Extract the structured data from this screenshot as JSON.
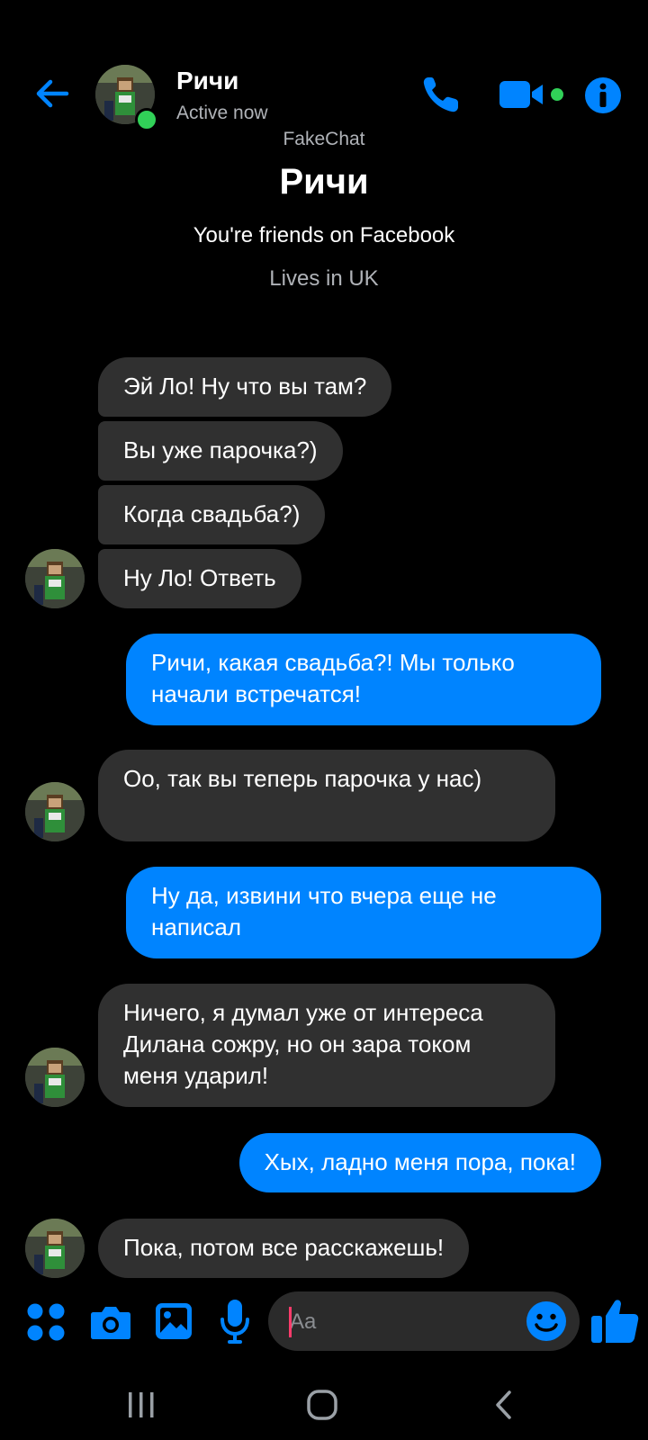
{
  "header": {
    "contact_name": "Ричи",
    "status": "Active now",
    "watermark": "FakeChat",
    "icons": [
      "back-arrow-icon",
      "phone-icon",
      "video-camera-icon",
      "info-icon"
    ]
  },
  "profile": {
    "name": "Ричи",
    "friends_text": "You're friends on Facebook",
    "lives_text": "Lives in UK"
  },
  "messages": [
    {
      "from": "contact",
      "text": "Эй Ло! Ну что вы там?"
    },
    {
      "from": "contact",
      "text": "Вы уже парочка?)"
    },
    {
      "from": "contact",
      "text": "Когда свадьба?)"
    },
    {
      "from": "contact",
      "text": "Ну Ло! Ответь"
    },
    {
      "from": "me",
      "text": "Ричи, какая свадьба?! Мы только начали встречатся!"
    },
    {
      "from": "contact",
      "text": "Оо, так вы теперь парочка у нас)"
    },
    {
      "from": "me",
      "text": "Ну да, извини что вчера еще не написал"
    },
    {
      "from": "contact",
      "text": "Ничего, я думал уже от интереса Дилана сожру, но он зара током меня ударил!"
    },
    {
      "from": "me",
      "text": "Хых, ладно меня пора, пока!"
    },
    {
      "from": "contact",
      "text": "Пока, потом все расскажешь!"
    }
  ],
  "composer": {
    "placeholder": "Aa",
    "icons": [
      "apps-icon",
      "camera-icon",
      "gallery-icon",
      "microphone-icon",
      "emoji-icon",
      "thumbs-up-icon"
    ]
  },
  "colors": {
    "accent": "#0084ff",
    "incoming_bubble": "#303030",
    "background": "#000000",
    "online": "#31d158"
  }
}
